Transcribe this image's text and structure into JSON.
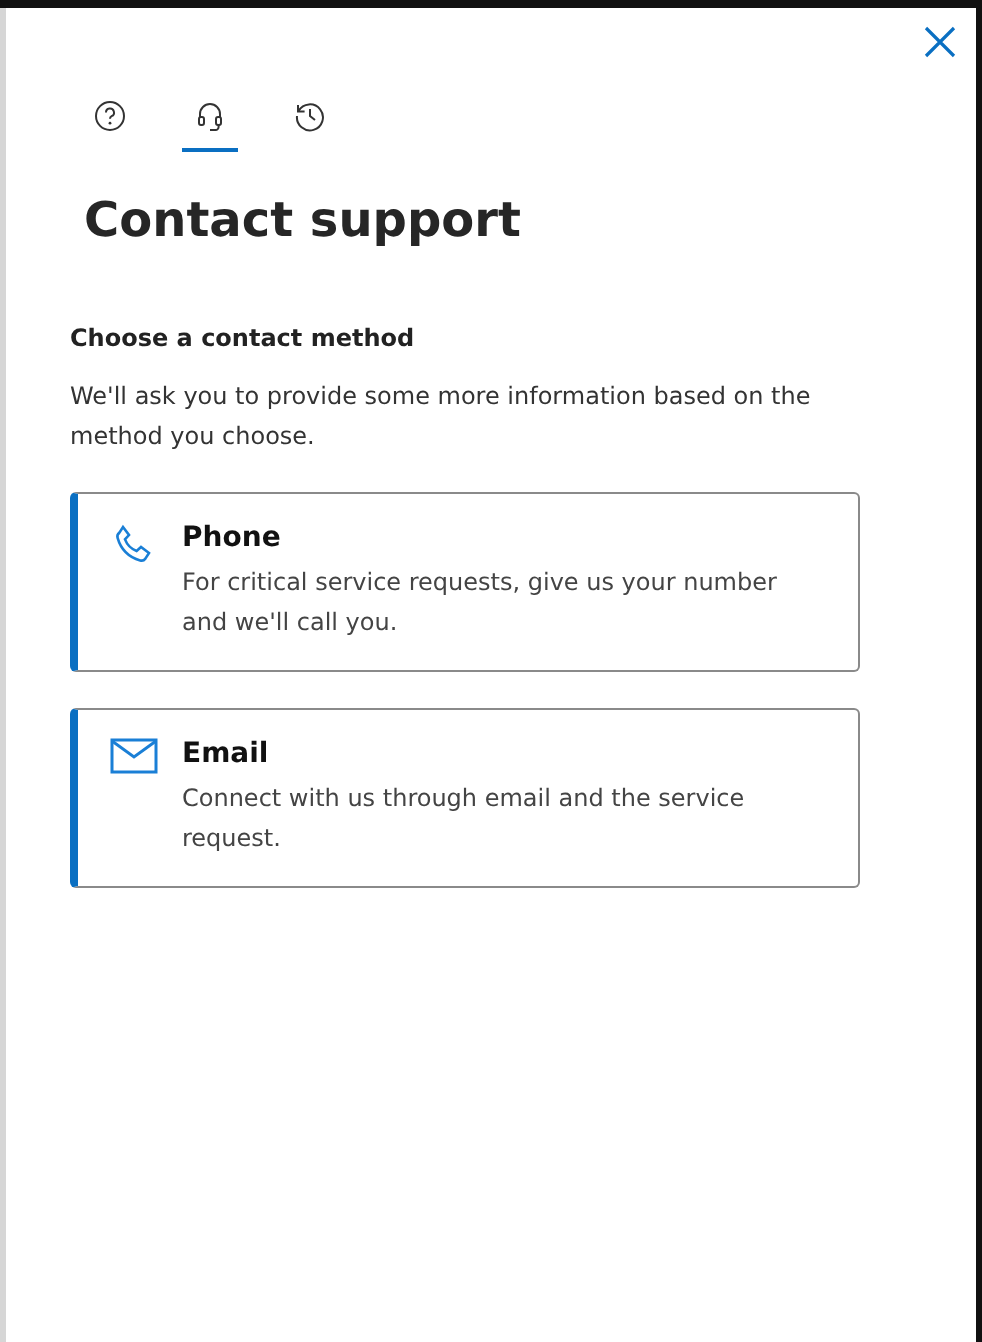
{
  "tabs": [
    {
      "kind": "help",
      "selected": false
    },
    {
      "kind": "headset",
      "selected": true
    },
    {
      "kind": "history",
      "selected": false
    }
  ],
  "title": "Contact support",
  "section": {
    "heading": "Choose a contact method",
    "description": "We'll ask you to provide some more information based on the method you choose."
  },
  "methods": [
    {
      "kind": "phone",
      "title": "Phone",
      "description": "For critical service requests, give us your number and we'll call you."
    },
    {
      "kind": "email",
      "title": "Email",
      "description": "Connect with us through email and the service request."
    }
  ]
}
